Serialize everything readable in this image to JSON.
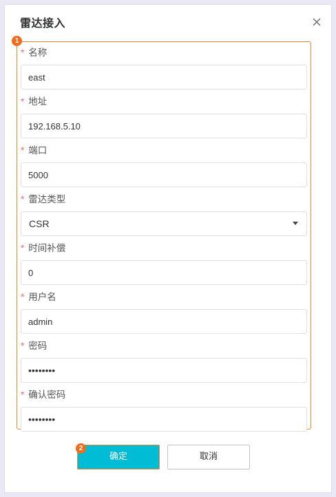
{
  "dialog": {
    "title": "雷达接入",
    "close_icon": "close-icon"
  },
  "markers": {
    "form": "1",
    "confirm": "2"
  },
  "colors": {
    "accent": "#00bcd4",
    "highlight_border": "#f0852e",
    "marker": "#f26b1d",
    "required": "#f56c6c"
  },
  "form": {
    "required_mark": "*",
    "name": {
      "label": "名称",
      "value": "east"
    },
    "address": {
      "label": "地址",
      "value": "192.168.5.10"
    },
    "port": {
      "label": "端口",
      "value": "5000"
    },
    "radar_type": {
      "label": "雷达类型",
      "value": "CSR"
    },
    "time_compensation": {
      "label": "时间补偿",
      "value": "0"
    },
    "username": {
      "label": "用户名",
      "value": "admin"
    },
    "password": {
      "label": "密码",
      "value": "••••••••"
    },
    "confirm_password": {
      "label": "确认密码",
      "value": "••••••••"
    }
  },
  "buttons": {
    "confirm": "确定",
    "cancel": "取消"
  }
}
